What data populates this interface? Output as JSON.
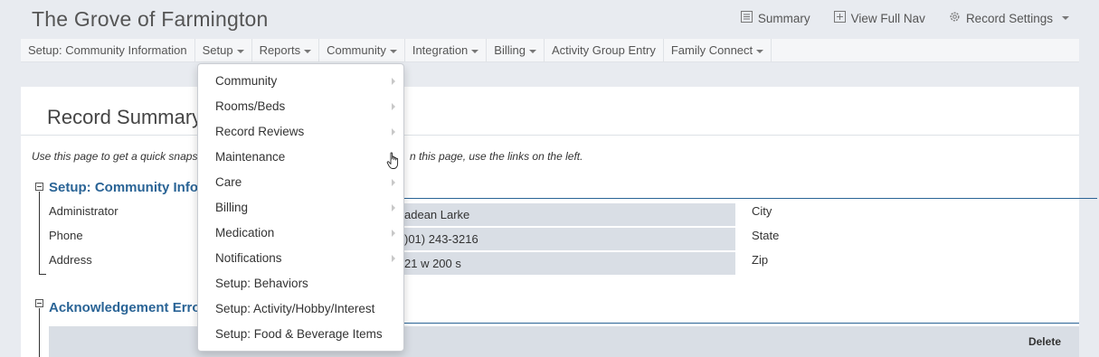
{
  "app": {
    "title": "The Grove of Farmington"
  },
  "top_actions": [
    {
      "label": "Summary",
      "icon": "list-icon"
    },
    {
      "label": "View Full Nav",
      "icon": "expand-icon"
    },
    {
      "label": "Record Settings",
      "icon": "gear-icon"
    }
  ],
  "nav": [
    {
      "label": "Setup: Community Information"
    },
    {
      "label": "Setup"
    },
    {
      "label": "Reports"
    },
    {
      "label": "Community"
    },
    {
      "label": "Integration"
    },
    {
      "label": "Billing"
    },
    {
      "label": "Activity Group Entry"
    },
    {
      "label": "Family Connect"
    }
  ],
  "page": {
    "title": "Record Summary",
    "intro_start": "Use this page to get a quick snapsh",
    "intro_end": "n this page, use the links on the left."
  },
  "community_section": {
    "title": "Setup: Community Info",
    "fields": [
      {
        "label": "Administrator",
        "value": "adean Larke"
      },
      {
        "label": "Phone",
        "value": ")01) 243-3216"
      },
      {
        "label": "Address",
        "value": "21 w 200 s"
      }
    ],
    "right_labels": [
      "City",
      "State",
      "Zip"
    ]
  },
  "ack_section": {
    "title": "Acknowledgement Erro",
    "delete_header": "Delete"
  },
  "setup_menu": [
    {
      "label": "Community",
      "submenu": true
    },
    {
      "label": "Rooms/Beds",
      "submenu": true
    },
    {
      "label": "Record Reviews",
      "submenu": true
    },
    {
      "label": "Maintenance",
      "submenu": true
    },
    {
      "label": "Care",
      "submenu": true
    },
    {
      "label": "Billing",
      "submenu": true
    },
    {
      "label": "Medication",
      "submenu": true
    },
    {
      "label": "Notifications",
      "submenu": true
    },
    {
      "label": "Setup: Behaviors",
      "submenu": false
    },
    {
      "label": "Setup: Activity/Hobby/Interest",
      "submenu": false
    },
    {
      "label": "Setup: Food & Beverage Items",
      "submenu": false
    }
  ]
}
